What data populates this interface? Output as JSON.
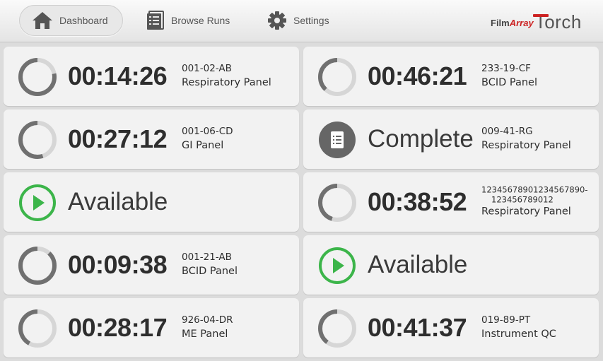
{
  "colors": {
    "accent_green": "#3cb54a",
    "ring_dark": "#707070",
    "ring_light": "#d6d6d6",
    "complete_icon_bg": "#666666",
    "brand_red": "#cc2222"
  },
  "nav": {
    "items": [
      {
        "label": "Dashboard",
        "icon": "home-icon",
        "active": true
      },
      {
        "label": "Browse Runs",
        "icon": "list-icon",
        "active": false
      },
      {
        "label": "Settings",
        "icon": "gear-icon",
        "active": false
      }
    ]
  },
  "brand": {
    "film": "Film",
    "array": "Array",
    "torch": "Torch"
  },
  "modules": [
    {
      "status": "running",
      "time": "00:14:26",
      "run_id": "001-02-AB",
      "panel": "Respiratory Panel",
      "progress": 0.78
    },
    {
      "status": "running",
      "time": "00:46:21",
      "run_id": "233-19-CF",
      "panel": "BCID Panel",
      "progress": 0.38
    },
    {
      "status": "running",
      "time": "00:27:12",
      "run_id": "001-06-CD",
      "panel": "GI Panel",
      "progress": 0.55
    },
    {
      "status": "complete",
      "time": "Complete",
      "run_id": "009-41-RG",
      "panel": "Respiratory Panel",
      "progress": 1
    },
    {
      "status": "available",
      "time": "Available",
      "run_id": "",
      "panel": "",
      "progress": 0
    },
    {
      "status": "running",
      "time": "00:38:52",
      "run_id": "12345678901234567890-123456789012",
      "run_id_line1": "12345678901234567890-",
      "run_id_line2": "123456789012",
      "panel": "Respiratory Panel",
      "progress": 0.45
    },
    {
      "status": "running",
      "time": "00:09:38",
      "run_id": "001-21-AB",
      "panel": "BCID Panel",
      "progress": 0.88
    },
    {
      "status": "available",
      "time": "Available",
      "run_id": "",
      "panel": "",
      "progress": 0
    },
    {
      "status": "running",
      "time": "00:28:17",
      "run_id": "926-04-DR",
      "panel": "ME Panel",
      "progress": 0.42
    },
    {
      "status": "running",
      "time": "00:41:37",
      "run_id": "019-89-PT",
      "panel": "Instrument QC",
      "progress": 0.4
    }
  ]
}
